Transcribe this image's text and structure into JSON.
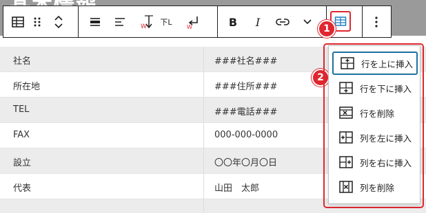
{
  "page": {
    "heading": "基本情報"
  },
  "table": {
    "rows": [
      {
        "label": "社名",
        "value": "###社名###"
      },
      {
        "label": "所在地",
        "value": "###住所###"
      },
      {
        "label": "TEL",
        "value": "###電話###"
      },
      {
        "label": "FAX",
        "value": "000-000-0000"
      },
      {
        "label": "設立",
        "value": "〇〇年〇月〇日"
      },
      {
        "label": "代表",
        "value": "山田　太郎"
      }
    ]
  },
  "toolbar": {
    "buttons": [
      {
        "icon": "table-icon"
      },
      {
        "icon": "drag-handle-icon"
      },
      {
        "icon": "move-up-down-icon"
      },
      {
        "icon": "align-icon"
      },
      {
        "icon": "text-align-icon"
      },
      {
        "icon": "vertical-text-icon",
        "text": "下L"
      },
      {
        "icon": "line-break-icon"
      },
      {
        "icon": "bold-icon",
        "text": "B"
      },
      {
        "icon": "italic-icon",
        "text": "I"
      },
      {
        "icon": "link-icon"
      },
      {
        "icon": "chevron-down-icon"
      },
      {
        "icon": "edit-table-icon"
      },
      {
        "icon": "more-options-icon"
      }
    ]
  },
  "markers": {
    "one": "1",
    "two": "2"
  },
  "menu": {
    "items": [
      {
        "label": "行を上に挿入",
        "icon": "insert-row-above-icon"
      },
      {
        "label": "行を下に挿入",
        "icon": "insert-row-below-icon"
      },
      {
        "label": "行を削除",
        "icon": "delete-row-icon"
      },
      {
        "label": "列を左に挿入",
        "icon": "insert-column-left-icon"
      },
      {
        "label": "列を右に挿入",
        "icon": "insert-column-right-icon"
      },
      {
        "label": "列を削除",
        "icon": "delete-column-icon"
      }
    ]
  },
  "colors": {
    "accent_red": "#e0262f",
    "focus_blue": "#1f6f9f",
    "row_shade": "#ececec"
  }
}
